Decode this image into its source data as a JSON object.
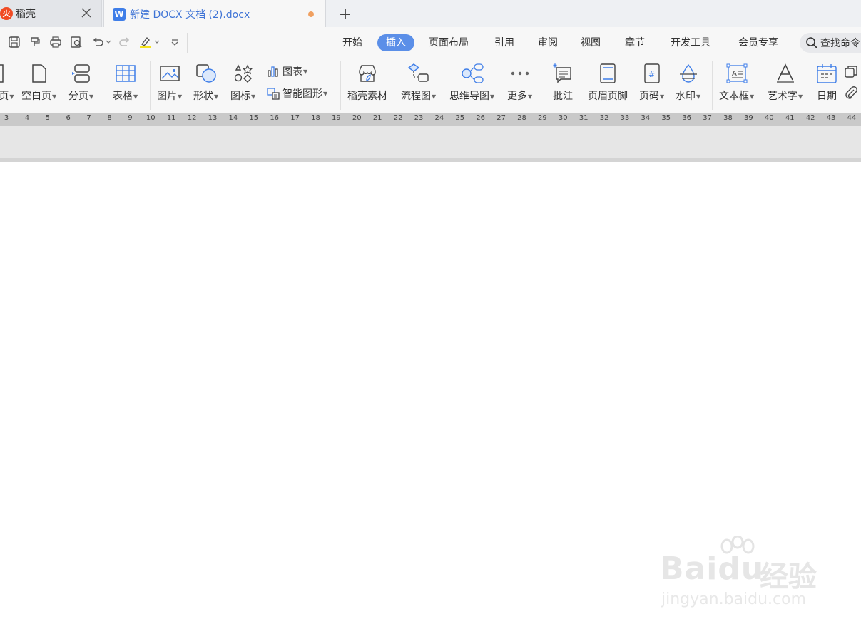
{
  "tabs": [
    {
      "title": "稻壳",
      "icon": "daoke-logo-icon"
    },
    {
      "title": "新建 DOCX 文档 (2).docx",
      "icon": "wps-writer-icon",
      "unsaved": true
    }
  ],
  "new_tab_label": "+",
  "menu": [
    "开始",
    "插入",
    "页面布局",
    "引用",
    "审阅",
    "视图",
    "章节",
    "开发工具",
    "会员专享"
  ],
  "active_menu": "插入",
  "search": {
    "text": "查找命令"
  },
  "ribbon": {
    "cover_page": "页",
    "blank_page": "空白页",
    "page_break": "分页",
    "table": "表格",
    "picture": "图片",
    "shape": "形状",
    "icon": "图标",
    "chart": "图表",
    "smart_art": "智能图形",
    "daoke_material": "稻壳素材",
    "flowchart": "流程图",
    "mindmap": "思维导图",
    "more": "更多",
    "comment": "批注",
    "header_footer": "页眉页脚",
    "page_number": "页码",
    "watermark": "水印",
    "textbox": "文本框",
    "wordart": "艺术字",
    "date": "日期"
  },
  "ruler": [
    "3",
    "4",
    "5",
    "6",
    "7",
    "8",
    "9",
    "10",
    "11",
    "12",
    "13",
    "14",
    "15",
    "16",
    "17",
    "18",
    "19",
    "20",
    "21",
    "22",
    "23",
    "24",
    "25",
    "26",
    "27",
    "28",
    "29",
    "30",
    "31",
    "32",
    "33",
    "34",
    "35",
    "36",
    "37",
    "38",
    "39",
    "40",
    "41",
    "42",
    "43",
    "44"
  ],
  "watermark": {
    "brand": "Baidu",
    "cn": "经验",
    "url": "jingyan.baidu.com"
  },
  "colors": {
    "accent": "#5b8fe8",
    "unsaved_dot": "#f0a060",
    "daoke": "#f04a23"
  }
}
